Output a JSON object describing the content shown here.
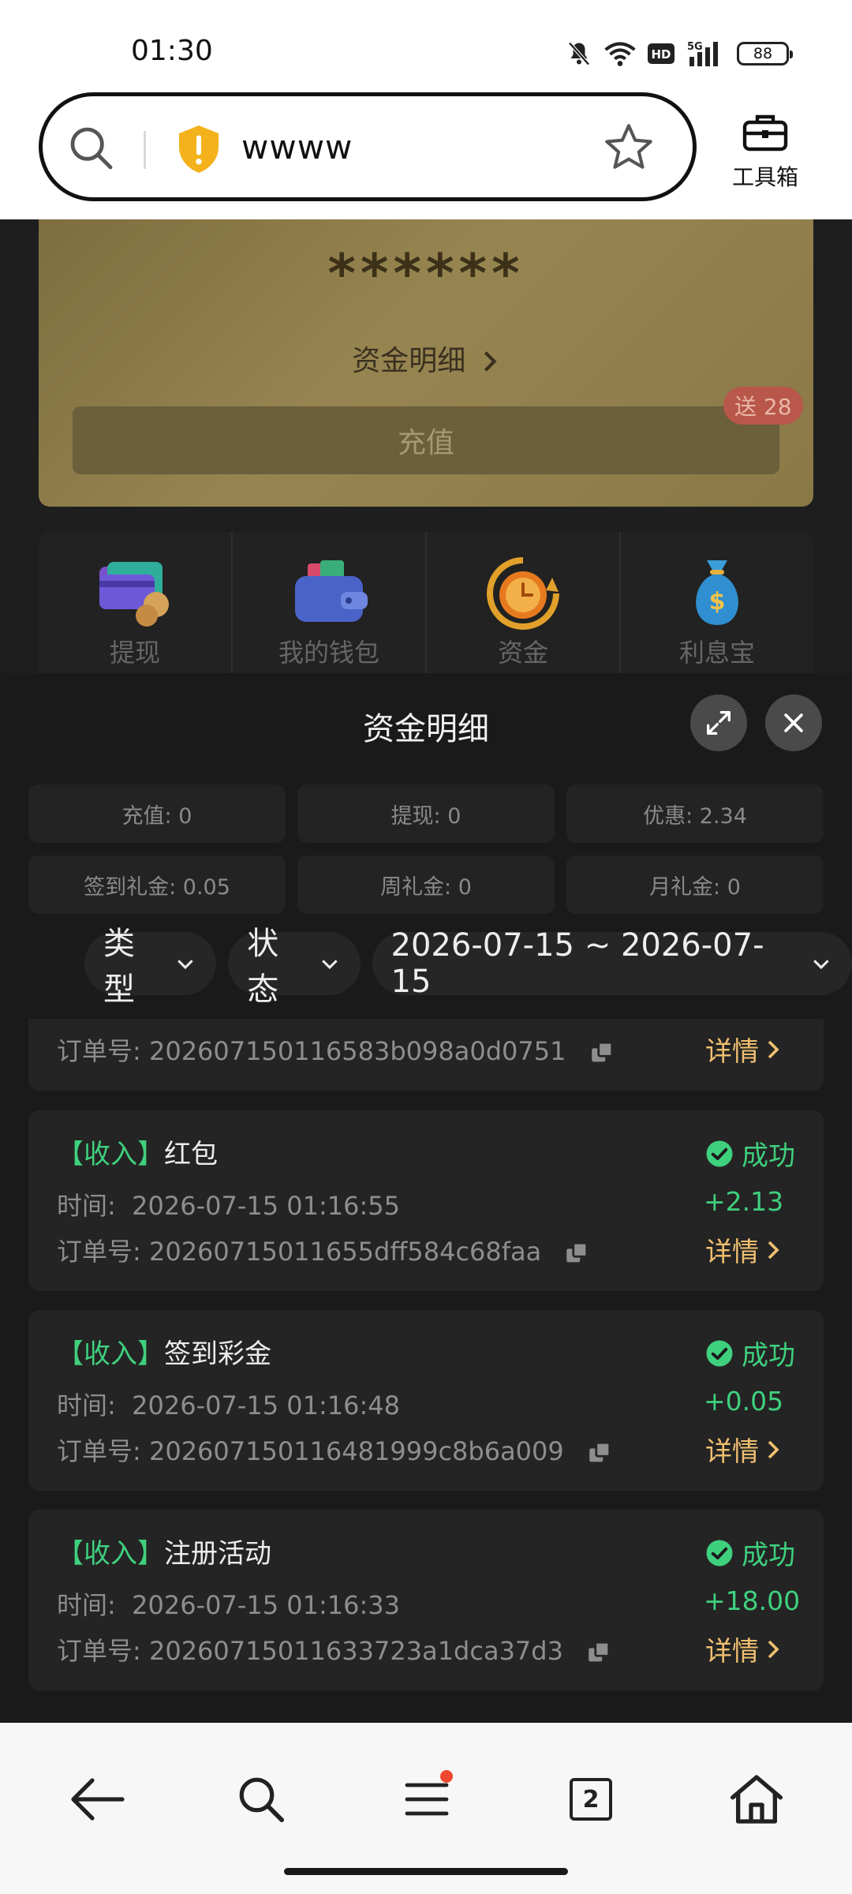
{
  "status_bar": {
    "time": "01:30",
    "battery": "88"
  },
  "address_bar": {
    "url": "wwww",
    "toolbox_label": "工具箱"
  },
  "page": {
    "masked_balance": "******",
    "fund_detail_link": "资金明细",
    "recharge_label": "充值",
    "promo_badge": "送 28",
    "quick_items": [
      {
        "label": "提现",
        "icon": "card-coin-icon"
      },
      {
        "label": "我的钱包",
        "icon": "wallet-icon"
      },
      {
        "label": "资金",
        "icon": "clock-coin-icon"
      },
      {
        "label": "利息宝",
        "icon": "money-bag-icon"
      }
    ]
  },
  "sheet": {
    "title": "资金明细",
    "stats": [
      "充值: 0",
      "提现: 0",
      "优惠: 2.34",
      "签到礼金: 0.05",
      "周礼金: 0",
      "月礼金: 0"
    ],
    "filters": {
      "type": "类型",
      "status": "状态",
      "date_range": "2026-07-15 ~ 2026-07-15"
    },
    "records": [
      {
        "order_label": "订单号:",
        "order_no": "202607150116583b098a0d0751",
        "detail": "详情"
      },
      {
        "tag": "【收入】",
        "type": "红包",
        "time_label": "时间:",
        "time": "2026-07-15 01:16:55",
        "order_label": "订单号:",
        "order_no": "20260715011655dff584c68faa",
        "status": "成功",
        "amount": "+2.13",
        "detail": "详情"
      },
      {
        "tag": "【收入】",
        "type": "签到彩金",
        "time_label": "时间:",
        "time": "2026-07-15 01:16:48",
        "order_label": "订单号:",
        "order_no": "202607150116481999c8b6a009",
        "status": "成功",
        "amount": "+0.05",
        "detail": "详情"
      },
      {
        "tag": "【收入】",
        "type": "注册活动",
        "time_label": "时间:",
        "time": "2026-07-15 01:16:33",
        "order_label": "订单号:",
        "order_no": "20260715011633723a1dca37d3",
        "status": "成功",
        "amount": "+18.00",
        "detail": "详情"
      }
    ]
  },
  "nav": {
    "tab_count": "2"
  },
  "colors": {
    "success": "#3fd07e",
    "detail": "#f0c070",
    "gold_card": "#978551",
    "badge": "#b8574a"
  }
}
